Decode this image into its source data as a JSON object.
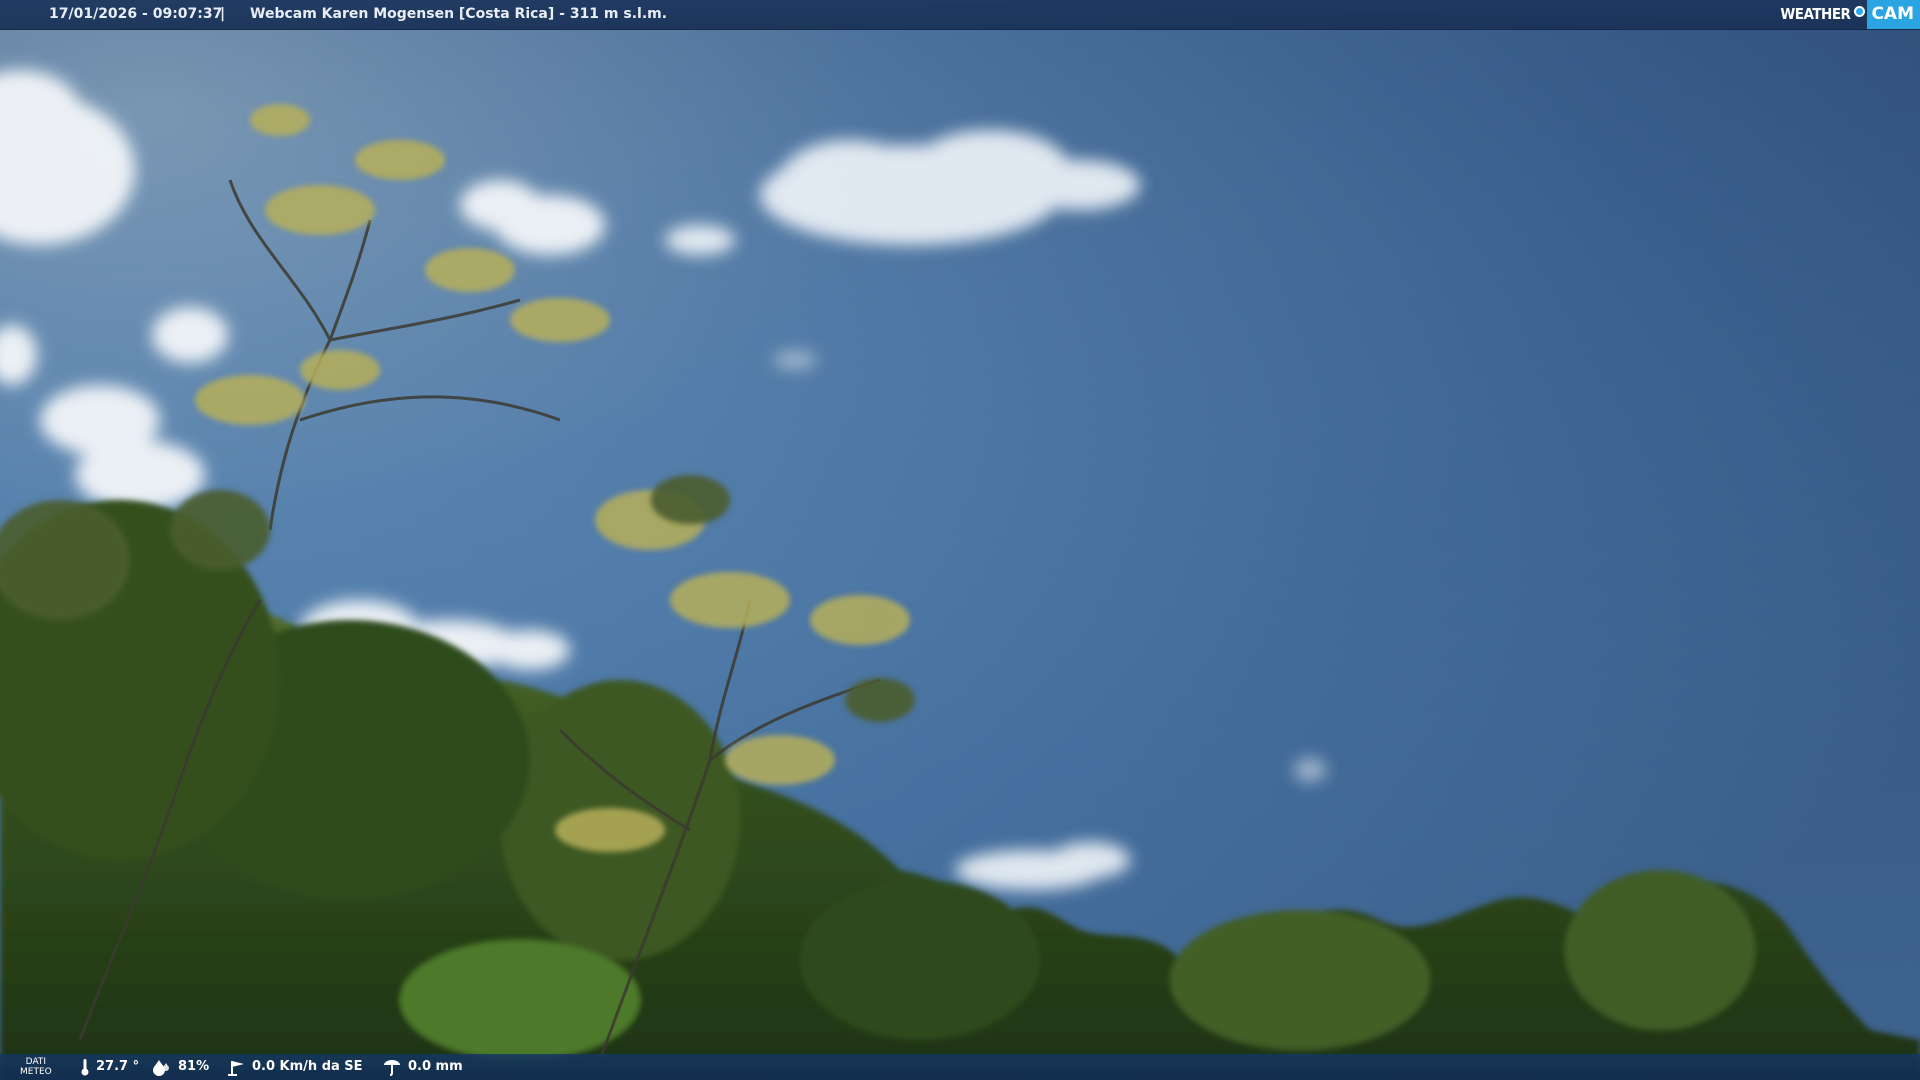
{
  "header": {
    "datetime": "17/01/2026 - 09:07:37",
    "separator": "|",
    "title": "Webcam Karen Mogensen [Costa Rica] - 311 m s.l.m."
  },
  "brand": {
    "weather_label": "WEATHER",
    "cam_label": "CAM",
    "accent_color": "#2aa5e2"
  },
  "weather_data": {
    "section_label_line1": "DATI",
    "section_label_line2": "METEO",
    "temperature": "27.7 °",
    "humidity": "81%",
    "wind": "0.0 Km/h da SE",
    "rain": "0.0 mm",
    "icons": {
      "temperature": "thermometer-icon",
      "humidity": "droplet-icon",
      "wind": "wind-icon",
      "rain": "rain-gauge-icon"
    }
  },
  "colors": {
    "bar_background": "#1e375f",
    "sky_top": "#33557d",
    "sky_bottom": "#5a8ab8",
    "foliage": "#2d4a1c"
  }
}
